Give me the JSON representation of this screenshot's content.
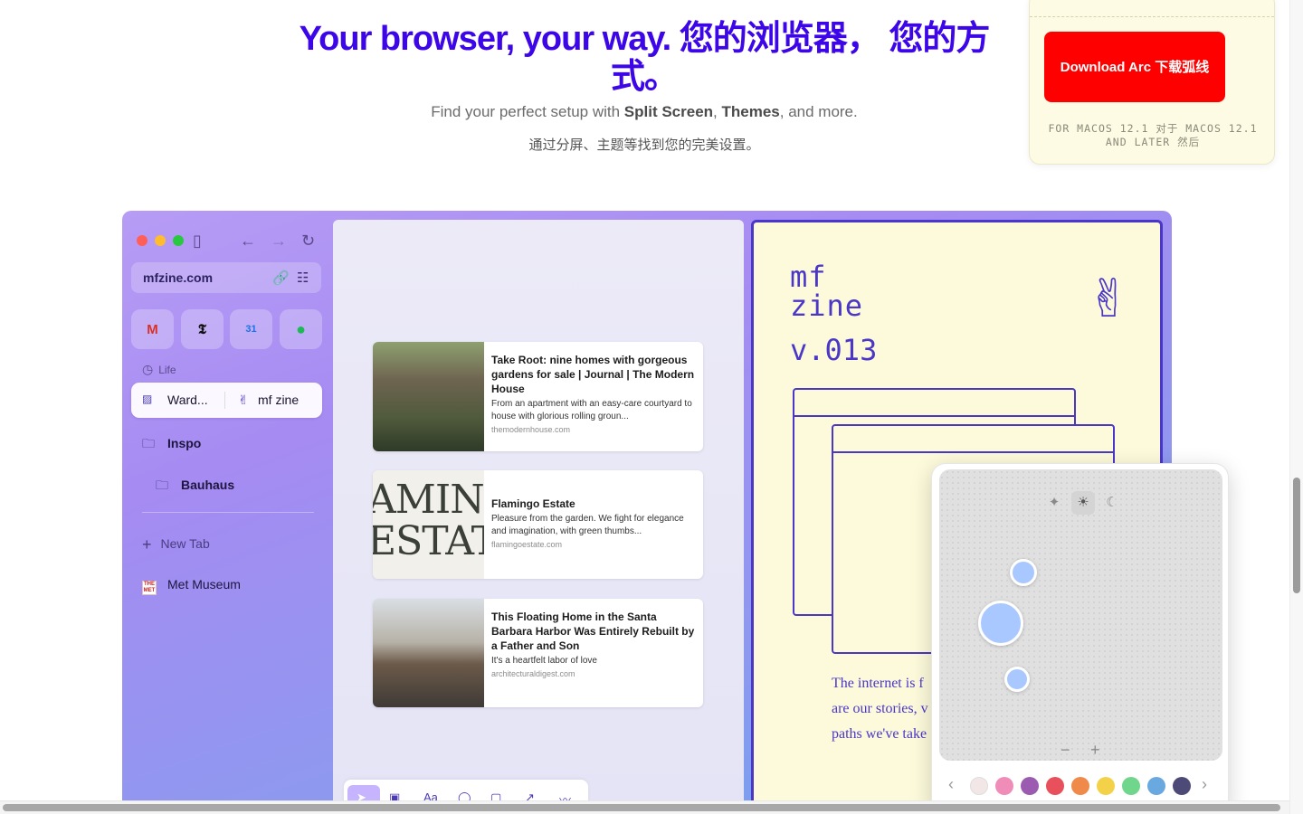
{
  "hero": {
    "title": "Your browser, your way. 您的浏览器， 您的方式。",
    "sub_prefix": "Find your perfect setup with ",
    "sub_split": "Split Screen",
    "sub_comma": ", ",
    "sub_themes": "Themes",
    "sub_suffix": ", and more.",
    "sub_cn": "通过分屏、主题等找到您的完美设置。"
  },
  "download": {
    "button_label": "Download Arc 下载弧线",
    "note": "FOR MACOS 12.1 对于 MACOS 12.1 AND LATER 然后"
  },
  "browser": {
    "url": "mfzine.com",
    "favorites": [
      {
        "name": "gmail",
        "glyph": "M",
        "color": "#d93025"
      },
      {
        "name": "nytimes",
        "glyph": "𝕿",
        "color": "#111111"
      },
      {
        "name": "calendar",
        "glyph": "31",
        "color": "#1a73e8"
      },
      {
        "name": "spotify",
        "glyph": "●",
        "color": "#1db954"
      }
    ],
    "section_label": "Life",
    "split_tab": {
      "left": "Ward...",
      "right": "mf zine"
    },
    "folders": [
      "Inspo",
      "Bauhaus"
    ],
    "new_tab": "New Tab",
    "pinned": "Met Museum",
    "met_icon_text": "THE MET"
  },
  "cards": [
    {
      "title": "Take Root: nine homes with gorgeous gardens for sale | Journal | The Modern House",
      "desc": "From an apartment with an easy-care courtyard to house with glorious rolling groun...",
      "domain": "themodernhouse.com"
    },
    {
      "title": "Flamingo Estate",
      "desc": "Pleasure from the garden. We fight for elegance and imagination, with green thumbs...",
      "domain": "flamingoestate.com",
      "thumb_line1": "AMINC",
      "thumb_line2": "ESTATI"
    },
    {
      "title": "This Floating Home in the Santa Barbara Harbor Was Entirely Rebuilt by a Father and Son",
      "desc": "It's a heartfelt labor of love",
      "domain": "architecturaldigest.com"
    }
  ],
  "zine": {
    "logo_line1": "mf",
    "logo_line2": "zine",
    "version": "v.013",
    "text_line1": "The internet is f",
    "text_line2": "are our stories, v",
    "text_line3": "paths we've take"
  },
  "theme_picker": {
    "modes": [
      "sparkle-icon",
      "sun-icon",
      "moon-icon"
    ],
    "active_mode": "sun-icon",
    "zoom_minus": "−",
    "zoom_plus": "+",
    "swatches": [
      "#f3e6e6",
      "#f08cb8",
      "#9a5bb0",
      "#e8505b",
      "#f08a4b",
      "#f3d24a",
      "#6fd68c",
      "#6aa8e0",
      "#4d4a78"
    ]
  },
  "colors": {
    "accent": "#3d06e8",
    "download": "#ff0000",
    "zine": "#4a37c8"
  }
}
